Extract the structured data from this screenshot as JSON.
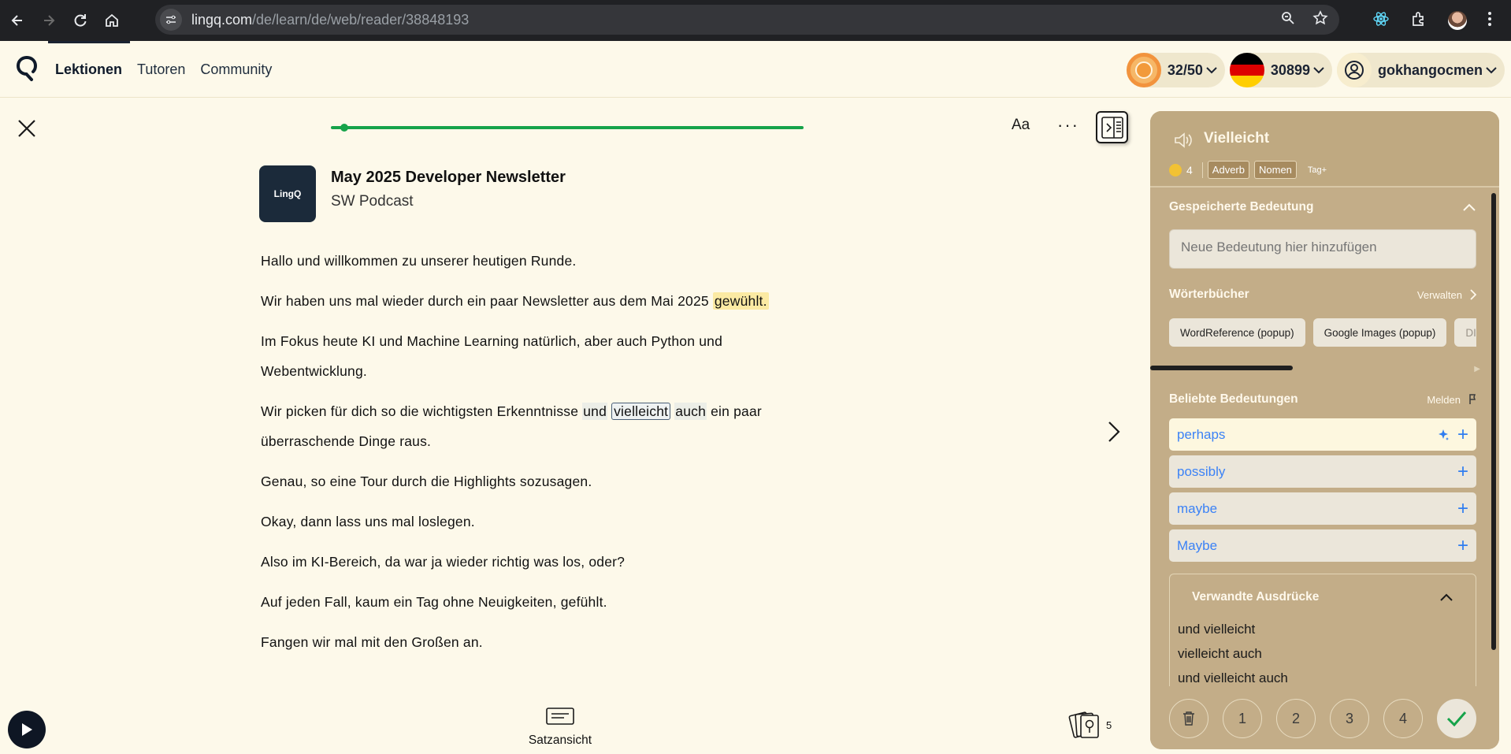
{
  "browser": {
    "url_host": "lingq.com",
    "url_path": "/de/learn/de/web/reader/38848193"
  },
  "header": {
    "nav": [
      "Lektionen",
      "Tutoren",
      "Community"
    ],
    "streak": "32/50",
    "coins": "30899",
    "username": "gokhangocmen",
    "flag_colors": [
      "#000000",
      "#dd0000",
      "#ffce00"
    ]
  },
  "reader": {
    "font_btn": "Aa",
    "more_btn": "···",
    "progress_fraction": 0.02,
    "lesson_thumb_text": "LingQ",
    "lesson_title": "May 2025 Developer Newsletter",
    "lesson_subtitle": "SW Podcast",
    "p1": "Hallo und willkommen zu unserer heutigen Runde.",
    "p2_a": "Wir haben uns mal wieder durch ein paar Newsletter aus dem Mai 2025 ",
    "p2_b": "gewühlt.",
    "p3": "Im Fokus heute KI und Machine Learning natürlich, aber auch Python und Webentwicklung.",
    "p4_a": "Wir picken für dich so die wichtigsten Erkenntnisse ",
    "p4_und": "und",
    "p4_word": "vielleicht",
    "p4_auch": "auch",
    "p4_b": " ein paar überraschende Dinge raus.",
    "p5": "Genau, so eine Tour durch die Highlights sozusagen.",
    "p6": "Okay, dann lass uns mal loslegen.",
    "p7": "Also im KI-Bereich, da war ja wieder richtig was los, oder?",
    "p8": "Auf jeden Fall, kaum ein Tag ohne Neuigkeiten, gefühlt.",
    "p9": "Fangen wir mal mit den Großen an.",
    "sentence_view": "Satzansicht",
    "cards_count": "5"
  },
  "panel": {
    "word": "Vielleicht",
    "count": "4",
    "tags": [
      "Adverb",
      "Nomen"
    ],
    "tag_add": "Tag+",
    "saved_title": "Gespeicherte Bedeutung",
    "meaning_placeholder": "Neue Bedeutung hier hinzufügen",
    "dicts_title": "Wörterbücher",
    "dicts_manage": "Verwalten",
    "dict_chips": [
      "WordReference (popup)",
      "Google Images (popup)",
      "DI"
    ],
    "popular_title": "Beliebte Bedeutungen",
    "popular_report": "Melden",
    "popular": [
      "perhaps",
      "possibly",
      "maybe",
      "Maybe"
    ],
    "related_title": "Verwandte Ausdrücke",
    "related": [
      "und vielleicht",
      "vielleicht auch",
      "und vielleicht auch"
    ],
    "status_levels": [
      "1",
      "2",
      "3",
      "4"
    ],
    "accent_blue": "#3b82f6",
    "panel_color": "#c3ad88"
  }
}
